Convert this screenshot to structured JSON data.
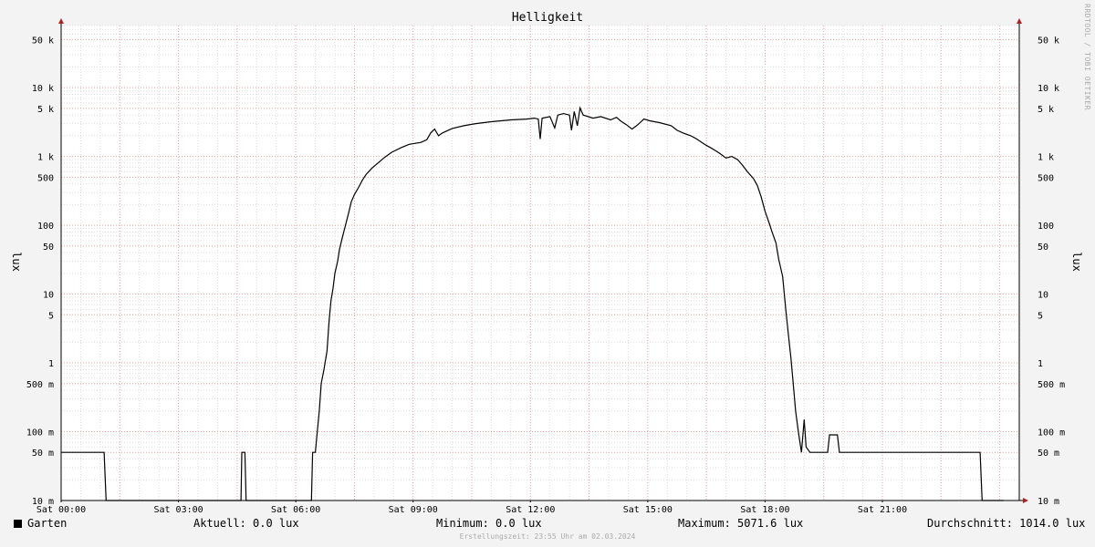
{
  "chart_data": {
    "type": "line",
    "title": "Helligkeit",
    "ylabel": "lux",
    "ylabel_right": "lux",
    "y_scale": "log",
    "ylim": [
      0.01,
      80000
    ],
    "xlim_hours": [
      0,
      24.5
    ],
    "x_ticks": [
      {
        "hour": 0,
        "label": "Sat 00:00"
      },
      {
        "hour": 3,
        "label": "Sat 03:00"
      },
      {
        "hour": 6,
        "label": "Sat 06:00"
      },
      {
        "hour": 9,
        "label": "Sat 09:00"
      },
      {
        "hour": 12,
        "label": "Sat 12:00"
      },
      {
        "hour": 15,
        "label": "Sat 15:00"
      },
      {
        "hour": 18,
        "label": "Sat 18:00"
      },
      {
        "hour": 21,
        "label": "Sat 21:00"
      }
    ],
    "y_ticks": [
      {
        "value": 0.01,
        "label": "10 m"
      },
      {
        "value": 0.05,
        "label": "50 m"
      },
      {
        "value": 0.1,
        "label": "100 m"
      },
      {
        "value": 0.5,
        "label": "500 m"
      },
      {
        "value": 1,
        "label": "1"
      },
      {
        "value": 5,
        "label": "5"
      },
      {
        "value": 10,
        "label": "10"
      },
      {
        "value": 50,
        "label": "50"
      },
      {
        "value": 100,
        "label": "100"
      },
      {
        "value": 500,
        "label": "500"
      },
      {
        "value": 1000,
        "label": "1 k"
      },
      {
        "value": 5000,
        "label": "5 k"
      },
      {
        "value": 10000,
        "label": "10 k"
      },
      {
        "value": 50000,
        "label": "50 k"
      }
    ],
    "grid": true,
    "series": [
      {
        "name": "Garten",
        "color": "#000000",
        "points": [
          [
            0.0,
            0.05
          ],
          [
            1.1,
            0.05
          ],
          [
            1.15,
            0.01
          ],
          [
            4.6,
            0.01
          ],
          [
            4.62,
            0.05
          ],
          [
            4.7,
            0.05
          ],
          [
            4.73,
            0.01
          ],
          [
            6.4,
            0.01
          ],
          [
            6.43,
            0.05
          ],
          [
            6.5,
            0.05
          ],
          [
            6.55,
            0.1
          ],
          [
            6.6,
            0.2
          ],
          [
            6.65,
            0.5
          ],
          [
            6.72,
            0.8
          ],
          [
            6.8,
            1.5
          ],
          [
            6.85,
            4
          ],
          [
            6.9,
            8
          ],
          [
            6.95,
            12
          ],
          [
            7.0,
            20
          ],
          [
            7.07,
            30
          ],
          [
            7.12,
            45
          ],
          [
            7.2,
            70
          ],
          [
            7.27,
            100
          ],
          [
            7.35,
            150
          ],
          [
            7.42,
            220
          ],
          [
            7.5,
            280
          ],
          [
            7.6,
            350
          ],
          [
            7.7,
            450
          ],
          [
            7.8,
            550
          ],
          [
            7.95,
            680
          ],
          [
            8.1,
            800
          ],
          [
            8.25,
            950
          ],
          [
            8.45,
            1150
          ],
          [
            8.7,
            1350
          ],
          [
            8.9,
            1500
          ],
          [
            9.2,
            1600
          ],
          [
            9.35,
            1750
          ],
          [
            9.45,
            2200
          ],
          [
            9.55,
            2500
          ],
          [
            9.65,
            2000
          ],
          [
            9.75,
            2200
          ],
          [
            10.0,
            2550
          ],
          [
            10.3,
            2800
          ],
          [
            10.6,
            3000
          ],
          [
            11.0,
            3200
          ],
          [
            11.5,
            3400
          ],
          [
            11.9,
            3500
          ],
          [
            12.1,
            3600
          ],
          [
            12.2,
            3500
          ],
          [
            12.25,
            1800
          ],
          [
            12.3,
            3600
          ],
          [
            12.5,
            3800
          ],
          [
            12.62,
            2600
          ],
          [
            12.7,
            4000
          ],
          [
            12.85,
            4200
          ],
          [
            13.0,
            4000
          ],
          [
            13.05,
            2400
          ],
          [
            13.12,
            4500
          ],
          [
            13.2,
            2800
          ],
          [
            13.27,
            5071.6
          ],
          [
            13.35,
            4000
          ],
          [
            13.6,
            3600
          ],
          [
            13.8,
            3800
          ],
          [
            14.05,
            3400
          ],
          [
            14.2,
            3700
          ],
          [
            14.3,
            3300
          ],
          [
            14.45,
            2900
          ],
          [
            14.6,
            2500
          ],
          [
            14.75,
            2900
          ],
          [
            14.9,
            3500
          ],
          [
            15.05,
            3300
          ],
          [
            15.3,
            3100
          ],
          [
            15.6,
            2800
          ],
          [
            15.75,
            2400
          ],
          [
            15.9,
            2200
          ],
          [
            16.1,
            2000
          ],
          [
            16.25,
            1800
          ],
          [
            16.45,
            1500
          ],
          [
            16.6,
            1350
          ],
          [
            16.75,
            1200
          ],
          [
            16.85,
            1100
          ],
          [
            17.0,
            950
          ],
          [
            17.15,
            1000
          ],
          [
            17.3,
            900
          ],
          [
            17.42,
            750
          ],
          [
            17.55,
            600
          ],
          [
            17.7,
            480
          ],
          [
            17.8,
            380
          ],
          [
            17.9,
            260
          ],
          [
            18.0,
            160
          ],
          [
            18.1,
            110
          ],
          [
            18.18,
            80
          ],
          [
            18.28,
            55
          ],
          [
            18.35,
            32
          ],
          [
            18.45,
            18
          ],
          [
            18.53,
            6
          ],
          [
            18.6,
            2.5
          ],
          [
            18.66,
            1.2
          ],
          [
            18.72,
            0.5
          ],
          [
            18.78,
            0.2
          ],
          [
            18.85,
            0.1
          ],
          [
            18.93,
            0.05
          ],
          [
            19.0,
            0.15
          ],
          [
            19.05,
            0.06
          ],
          [
            19.15,
            0.05
          ],
          [
            19.6,
            0.05
          ],
          [
            19.65,
            0.09
          ],
          [
            19.85,
            0.09
          ],
          [
            19.9,
            0.05
          ],
          [
            23.5,
            0.05
          ],
          [
            23.55,
            0.01
          ],
          [
            24.1,
            0.01
          ]
        ]
      }
    ]
  },
  "legend": {
    "series_name": "Garten",
    "current": "Aktuell:    0.0 lux",
    "minimum": "Minimum:    0.0 lux",
    "maximum": "Maximum: 5071.6 lux",
    "average": "Durchschnitt: 1014.0 lux"
  },
  "footer": "Erstellungszeit: 23:55 Uhr am 02.03.2024",
  "watermark": "RRDTOOL / TOBI OETIKER",
  "colors": {
    "background": "#f3f3f3",
    "canvas": "#ffffff",
    "major_grid": "#e8a0a0",
    "minor_grid": "#dddddd",
    "axis_arrow": "#aa2222",
    "line": "#000000"
  }
}
